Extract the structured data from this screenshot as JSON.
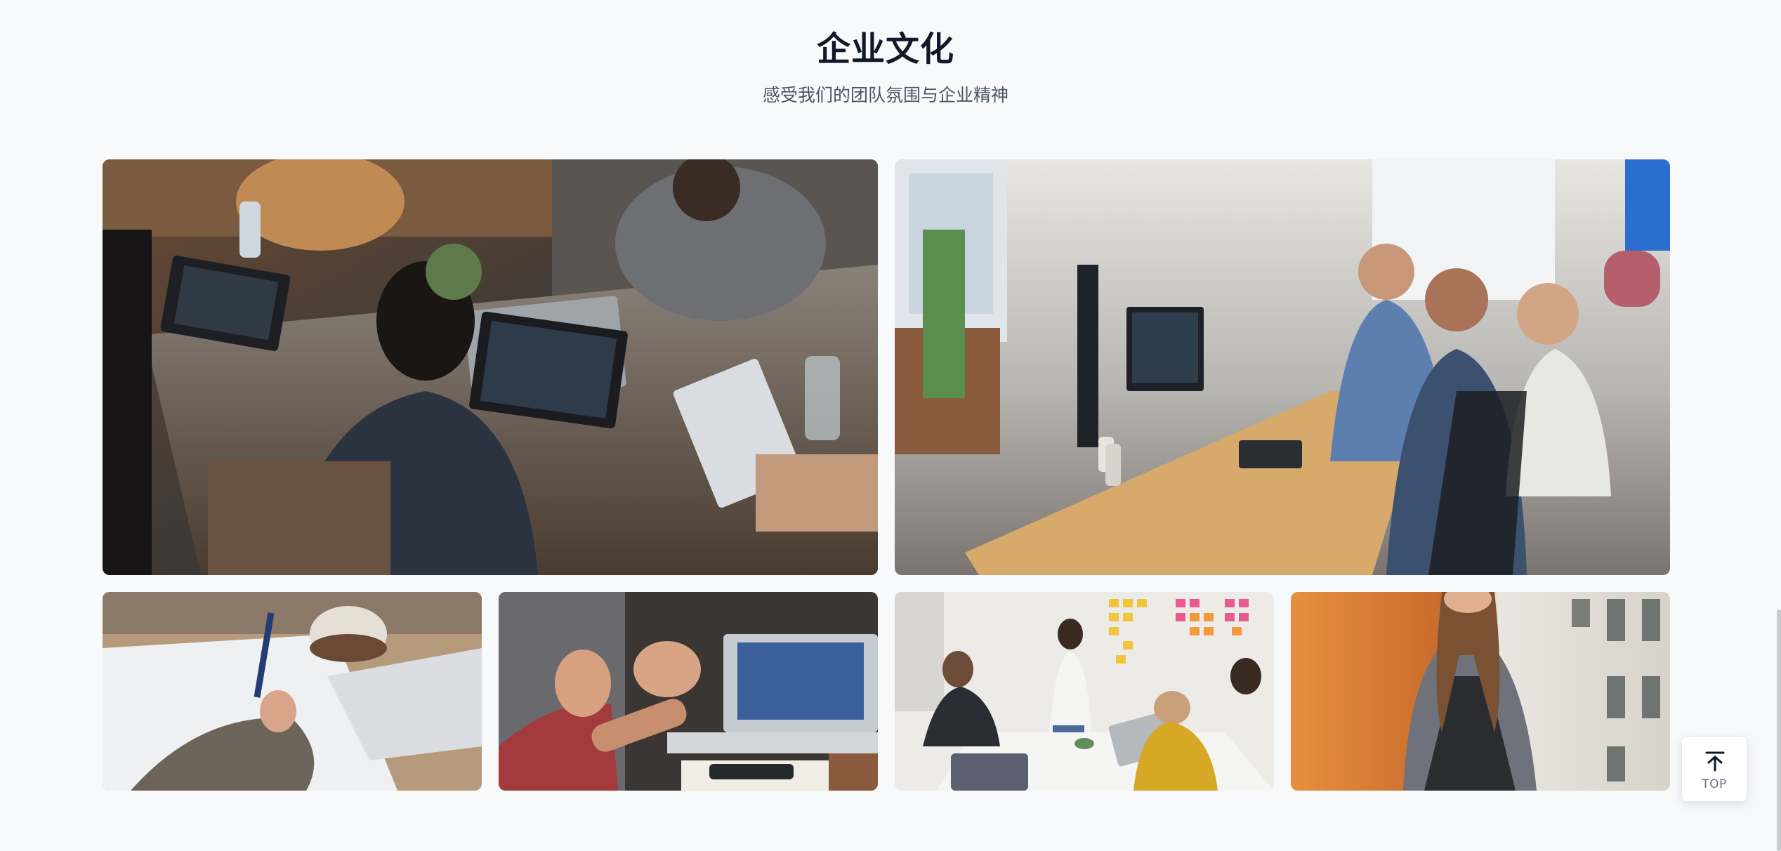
{
  "culture": {
    "title": "企业文化",
    "subtitle": "感受我们的团队氛围与企业精神"
  },
  "gallery": {
    "photos": [
      {
        "name": "team-laptops-photo"
      },
      {
        "name": "open-office-meeting-photo"
      },
      {
        "name": "handwriting-notes-photo"
      },
      {
        "name": "laptop-discussion-photo"
      },
      {
        "name": "whiteboard-presentation-photo"
      },
      {
        "name": "professional-woman-photo"
      }
    ]
  },
  "back_to_top": {
    "label": "TOP",
    "icon": "arrow-up-to-line-icon"
  }
}
